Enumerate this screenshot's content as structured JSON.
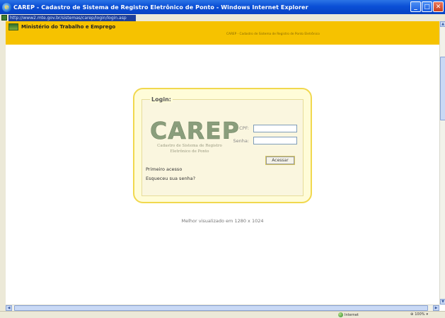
{
  "window": {
    "title": "CAREP - Cadastro de Sistema de Registro Eletrônico de Ponto - Windows Internet Explorer",
    "controls": [
      "minimize",
      "maximize",
      "close"
    ]
  },
  "address_bar": {
    "url": "http://www2.mte.gov.br/sistemas/carep/login/login.asp"
  },
  "site_header": {
    "ministry": "Ministério do Trabalho e Emprego",
    "system_name": "CAREP - Cadastro de Sistema de Registro de Ponto Eletrônico"
  },
  "login": {
    "legend": "Login:",
    "logo": {
      "word": "CAREP",
      "subtitle_line1": "Cadastro de Sistema de Registro",
      "subtitle_line2": "Eletrônico de Ponto"
    },
    "cpf_label": "CPF:",
    "senha_label": "Senha:",
    "cpf_value": "",
    "senha_value": "",
    "submit_label": "Acessar",
    "first_access_link": "Primeiro acesso",
    "forgot_password_link": "Esqueceu sua senha?"
  },
  "resolution_note": "Melhor visualizado em 1280 x 1024",
  "status_bar": {
    "zone": "Internet",
    "zoom": "100%"
  },
  "colors": {
    "header_yellow": "#f6c200",
    "panel_border": "#f1d84e",
    "title_blue": "#0a4fd6"
  }
}
